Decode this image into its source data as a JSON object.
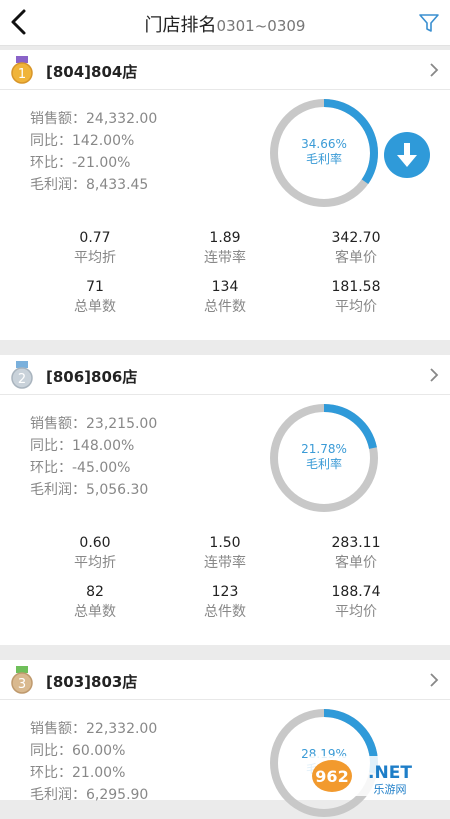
{
  "header": {
    "title": "门店排名",
    "date_range": "0301~0309",
    "back_icon": "chevron-left-icon",
    "filter_icon": "filter-icon"
  },
  "accent_color": "#2f9ad9",
  "labels": {
    "sales_prefix": "销售额：",
    "yoy_prefix": "同比：",
    "mom_prefix": "环比：",
    "profit_prefix": "毛利润：",
    "gross_margin": "毛利率",
    "avg_discount": "平均折",
    "attach_rate": "连带率",
    "avg_ticket": "客单价",
    "total_orders": "总单数",
    "total_items": "总件数",
    "avg_price": "平均价"
  },
  "stores": [
    {
      "rank": "1",
      "medal": "gold",
      "name": "[804]804店",
      "sales": "24,332.00",
      "yoy": "142.00%",
      "mom": "-21.00%",
      "profit": "8,433.45",
      "margin_text": "34.66%",
      "margin_value": 34.66,
      "avg_discount": "0.77",
      "attach_rate": "1.89",
      "avg_ticket": "342.70",
      "total_orders": "71",
      "total_items": "134",
      "avg_price": "181.58",
      "has_download": true
    },
    {
      "rank": "2",
      "medal": "silver",
      "name": "[806]806店",
      "sales": "23,215.00",
      "yoy": "148.00%",
      "mom": "-45.00%",
      "profit": "5,056.30",
      "margin_text": "21.78%",
      "margin_value": 21.78,
      "avg_discount": "0.60",
      "attach_rate": "1.50",
      "avg_ticket": "283.11",
      "total_orders": "82",
      "total_items": "123",
      "avg_price": "188.74",
      "has_download": false
    },
    {
      "rank": "3",
      "medal": "bronze",
      "name": "[803]803店",
      "sales": "22,332.00",
      "yoy": "60.00%",
      "mom": "21.00%",
      "profit": "6,295.90",
      "margin_text": "28.19%",
      "margin_value": 28.19,
      "has_download": false
    }
  ],
  "watermark": {
    "brand": "962.NET",
    "subtitle": "乐游网"
  }
}
